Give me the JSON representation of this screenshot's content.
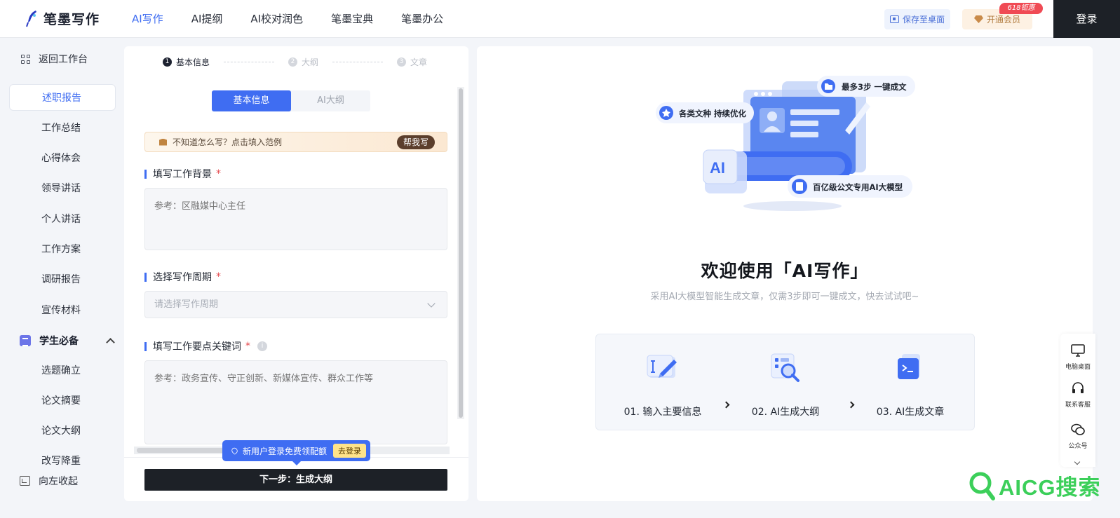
{
  "header": {
    "logo_text": "笔墨写作",
    "nav": [
      "AI写作",
      "AI提纲",
      "AI校对润色",
      "笔墨宝典",
      "笔墨办公"
    ],
    "save_desktop": "保存至桌面",
    "vip": "开通会员",
    "vip_badge": "618钜惠",
    "login": "登录"
  },
  "sidebar": {
    "back": "返回工作台",
    "items": [
      "述职报告",
      "工作总结",
      "心得体会",
      "领导讲话",
      "个人讲话",
      "工作方案",
      "调研报告",
      "宣传材料"
    ],
    "group": "学生必备",
    "group_items": [
      "选题确立",
      "论文摘要",
      "论文大纲",
      "改写降重"
    ],
    "collapse": "向左收起"
  },
  "form": {
    "steps": [
      {
        "num": "1",
        "label": "基本信息"
      },
      {
        "num": "2",
        "label": "大纲"
      },
      {
        "num": "3",
        "label": "文章"
      }
    ],
    "tabs": [
      "基本信息",
      "AI大纲"
    ],
    "hint": "不知道怎么写？点击填入范例",
    "help_button": "帮我写",
    "field1_label": "填写工作背景",
    "field1_placeholder": "参考：区融媒中心主任",
    "field2_label": "选择写作周期",
    "field2_placeholder": "请选择写作周期",
    "field3_label": "填写工作要点关键词",
    "field3_placeholder": "参考：政务宣传、守正创新、新媒体宣传、群众工作等",
    "required_mark": "*",
    "info_mark": "i",
    "tip_text": "新用户登录免费领配额",
    "tip_button": "去登录",
    "next_button": "下一步：生成大纲"
  },
  "welcome": {
    "bubble1": "最多3步 一键成文",
    "bubble2": "各类文种 持续优化",
    "bubble3": "百亿级公文专用AI大模型",
    "ai_tag": "AI",
    "title": "欢迎使用「AI写作」",
    "subtitle": "采用AI大模型智能生成文章，仅需3步即可一键成文，快去试试吧~",
    "steps": [
      "01. 输入主要信息",
      "02. AI生成大纲",
      "03. AI生成文章"
    ]
  },
  "float_bar": {
    "items": [
      "电脑桌面",
      "联系客服",
      "公众号"
    ]
  },
  "watermark": "AICG搜索",
  "colors": {
    "accent": "#3f6df2",
    "dark": "#1d2127",
    "required": "#e5484d",
    "watermark": "#3ccf5a"
  }
}
